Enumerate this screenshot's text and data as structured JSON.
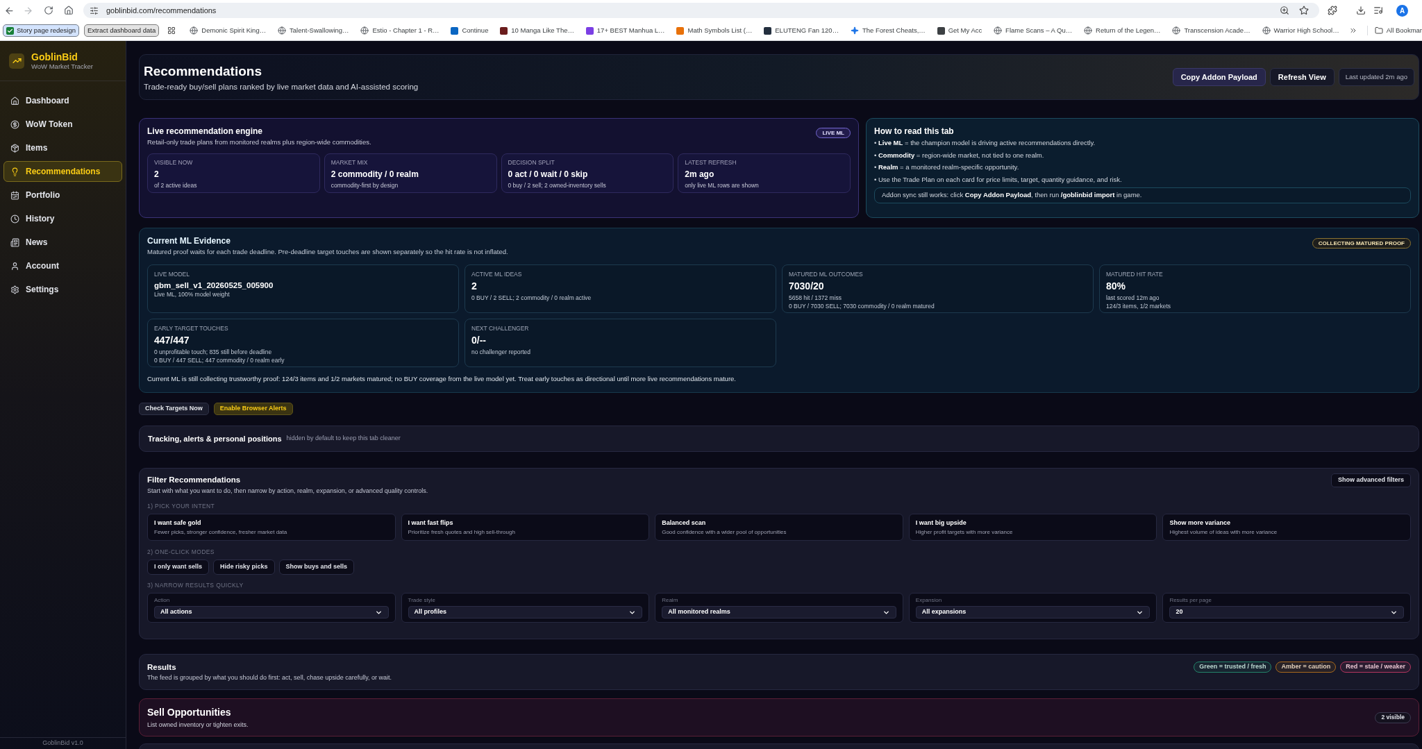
{
  "browser": {
    "url": "goblinbid.com/recommendations",
    "profile_initial": "A",
    "tab_groups": [
      {
        "label": "Story page redesign",
        "color": "#d3e3fd"
      },
      {
        "label": "Extract dashboard data",
        "color": "#e3e3e3"
      }
    ],
    "bookmarks": [
      "Demonic Spirit King…",
      "Talent-Swallowing…",
      "Estio - Chapter 1 - R…",
      "Continue",
      "10 Manga Like The…",
      "17+ BEST Manhua L…",
      "Math Symbols List (…",
      "ELUTENG Fan 120…",
      "The Forest Cheats,…",
      "Get My Acc",
      "Flame Scans – A Qu…",
      "Return of the Legen…",
      "Transcension Acade…",
      "Warrior High School…"
    ],
    "all_bookmarks": "All Bookmar"
  },
  "sidebar": {
    "brand": "GoblinBid",
    "tagline": "WoW Market Tracker",
    "items": [
      {
        "label": "Dashboard",
        "selected": false
      },
      {
        "label": "WoW Token",
        "selected": false
      },
      {
        "label": "Items",
        "selected": false
      },
      {
        "label": "Recommendations",
        "selected": true
      },
      {
        "label": "Portfolio",
        "selected": false
      },
      {
        "label": "History",
        "selected": false
      },
      {
        "label": "News",
        "selected": false
      },
      {
        "label": "Account",
        "selected": false
      },
      {
        "label": "Settings",
        "selected": false
      }
    ],
    "version": "GoblinBid v1.0"
  },
  "header": {
    "title": "Recommendations",
    "subtitle": "Trade-ready buy/sell plans ranked by live market data and AI-assisted scoring",
    "buttons": [
      {
        "label": "Copy Addon Payload",
        "kind": "primary"
      },
      {
        "label": "Refresh View",
        "kind": "secondary"
      }
    ],
    "last_updated": "Last updated 2m ago"
  },
  "engine": {
    "title": "Live recommendation engine",
    "subtitle": "Retail-only trade plans from monitored realms plus region-wide commodities.",
    "badge": "LIVE ML",
    "stats": [
      {
        "label": "VISIBLE NOW",
        "value": "2",
        "note": "of 2 active ideas"
      },
      {
        "label": "MARKET MIX",
        "value": "2 commodity / 0 realm",
        "note": "commodity-first by design"
      },
      {
        "label": "DECISION SPLIT",
        "value": "0 act / 0 wait / 0 skip",
        "note": "0 buy / 2 sell; 2 owned-inventory sells"
      },
      {
        "label": "LATEST REFRESH",
        "value": "2m ago",
        "note": "only live ML rows are shown"
      }
    ]
  },
  "guide": {
    "title": "How to read this tab",
    "bullets": [
      "• **Live ML** = the champion model is driving active recommendations directly.",
      "• **Commodity** = region-wide market, not tied to one realm.",
      "• **Realm** = a monitored realm-specific opportunity.",
      "• Use the Trade Plan on each card for price limits, target, quantity guidance, and risk."
    ],
    "note": "Addon sync still works: click **Copy Addon Payload**, then run **/goblinbid import** in game."
  },
  "evidence": {
    "title": "Current ML Evidence",
    "subtitle": "Matured proof waits for each trade deadline. Pre-deadline target touches are shown separately so the hit rate is not inflated.",
    "badge": "COLLECTING MATURED PROOF",
    "stats": [
      {
        "kind": "model",
        "label": "LIVE MODEL",
        "value": "gbm_sell_v1_20260525_005900",
        "notes": [
          "Live ML, 100% model weight"
        ]
      },
      {
        "kind": "metric",
        "label": "ACTIVE ML IDEAS",
        "value": "2",
        "notes": [
          "0 BUY / 2 SELL; 2 commodity / 0 realm active"
        ]
      },
      {
        "kind": "metric",
        "label": "MATURED ML OUTCOMES",
        "value": "7030/20",
        "notes": [
          "5658 hit / 1372 miss",
          "0 BUY / 7030 SELL; 7030 commodity / 0 realm matured"
        ]
      },
      {
        "kind": "metric",
        "label": "MATURED HIT RATE",
        "value": "80%",
        "notes": [
          "last scored 12m ago",
          "124/3 items, 1/2 markets"
        ]
      },
      {
        "kind": "metric",
        "label": "EARLY TARGET TOUCHES",
        "value": "447/447",
        "notes": [
          "0 unprofitable touch; 835 still before deadline",
          "0 BUY / 447 SELL; 447 commodity / 0 realm early"
        ]
      },
      {
        "kind": "metric",
        "label": "NEXT CHALLENGER",
        "value": "0/--",
        "notes": [
          "no challenger reported"
        ]
      }
    ],
    "footer": "Current ML is still collecting trustworthy proof: 124/3 items and 1/2 markets matured; no BUY coverage from the live model yet. Treat early touches as directional until more live recommendations mature."
  },
  "actions": [
    {
      "label": "Check Targets Now",
      "kind": "neutral"
    },
    {
      "label": "Enable Browser Alerts",
      "kind": "accent"
    }
  ],
  "tracking": {
    "title": "Tracking, alerts & personal positions",
    "hint": "hidden by default to keep this tab cleaner"
  },
  "filters": {
    "title": "Filter Recommendations",
    "subtitle": "Start with what you want to do, then narrow by action, realm, expansion, or advanced quality controls.",
    "advanced_button": "Show advanced filters",
    "intent_heading": "1) PICK YOUR INTENT",
    "intents": [
      {
        "title": "I want safe gold",
        "description": "Fewer picks, stronger confidence, fresher market data"
      },
      {
        "title": "I want fast flips",
        "description": "Prioritize fresh quotes and high sell-through"
      },
      {
        "title": "Balanced scan",
        "description": "Good confidence with a wider pool of opportunities"
      },
      {
        "title": "I want big upside",
        "description": "Higher profit targets with more variance"
      },
      {
        "title": "Show more variance",
        "description": "Highest volume of ideas with more variance"
      }
    ],
    "modes_heading": "2) ONE-CLICK MODES",
    "modes": [
      "I only want sells",
      "Hide risky picks",
      "Show buys and sells"
    ],
    "narrow_heading": "3) NARROW RESULTS QUICKLY",
    "selects": [
      {
        "label": "Action",
        "value": "All actions"
      },
      {
        "label": "Trade style",
        "value": "All profiles"
      },
      {
        "label": "Realm",
        "value": "All monitored realms"
      },
      {
        "label": "Expansion",
        "value": "All expansions"
      },
      {
        "label": "Results per page",
        "value": "20"
      }
    ]
  },
  "results": {
    "title": "Results",
    "subtitle": "The feed is grouped by what you should do first: act, sell, chase upside carefully, or wait.",
    "legend": [
      {
        "label": "Green = trusted / fresh",
        "color": "#23846a"
      },
      {
        "label": "Amber = caution",
        "color": "#a8691c"
      },
      {
        "label": "Red = stale / weaker",
        "color": "#b3365f"
      }
    ]
  },
  "sell": {
    "title": "Sell Opportunities",
    "subtitle": "List owned inventory or tighten exits.",
    "count": "2 visible"
  }
}
